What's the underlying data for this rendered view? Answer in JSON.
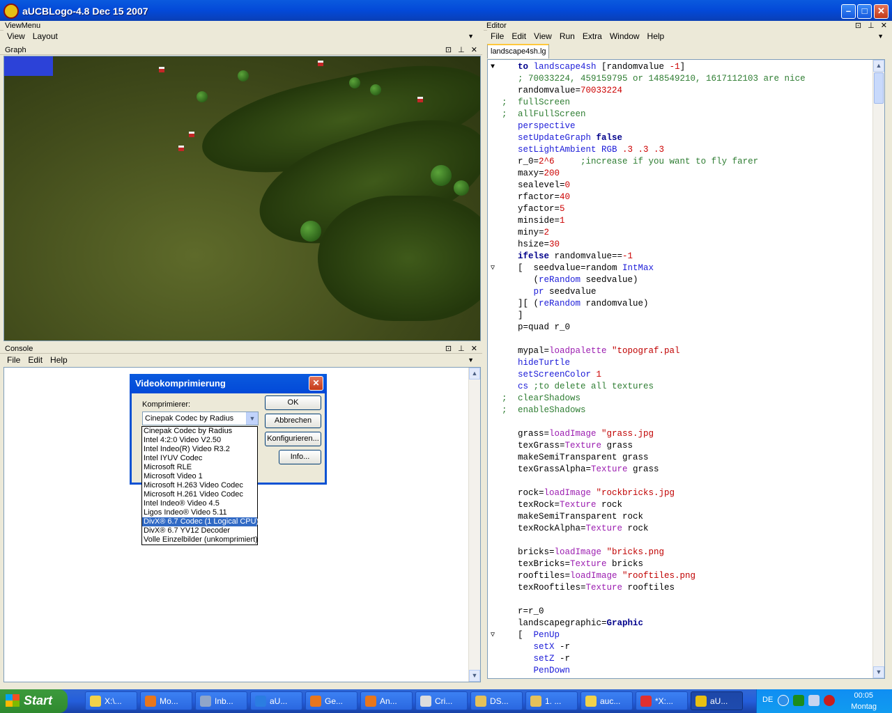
{
  "window": {
    "title": "aUCBLogo-4.8 Dec 15 2007"
  },
  "viewmenu": {
    "header": "ViewMenu",
    "items": [
      "View",
      "Layout"
    ]
  },
  "graph": {
    "header": "Graph"
  },
  "console": {
    "header": "Console",
    "menu": [
      "File",
      "Edit",
      "Help"
    ]
  },
  "editor": {
    "header": "Editor",
    "menu": [
      "File",
      "Edit",
      "View",
      "Run",
      "Extra",
      "Window",
      "Help"
    ],
    "tab": "landscape4sh.lg"
  },
  "dialog": {
    "title": "Videokomprimierung",
    "label": "Komprimierer:",
    "selected": "Cinepak Codec by Radius",
    "buttons": {
      "ok": "OK",
      "cancel": "Abbrechen",
      "configure": "Konfigurieren...",
      "info": "Info..."
    },
    "options": [
      "Cinepak Codec by Radius",
      "Intel 4:2:0 Video V2.50",
      "Intel Indeo(R) Video R3.2",
      "Intel IYUV Codec",
      "Microsoft RLE",
      "Microsoft Video 1",
      "Microsoft H.263 Video Codec",
      "Microsoft H.261 Video Codec",
      "Intel Indeo® Video 4.5",
      "Ligos Indeo® Video 5.11",
      "DivX® 6.7 Codec (1 Logical CPU)",
      "DivX® 6.7 YV12 Decoder",
      "Volle Einzelbilder (unkomprimiert)"
    ],
    "highlighted_index": 10
  },
  "code_lines": [
    {
      "fold": "▼",
      "segs": [
        [
          "k",
          "to "
        ],
        [
          "f",
          "landscape4sh "
        ],
        [
          "t",
          "[randomvalue "
        ],
        [
          "n",
          "-1"
        ],
        [
          "t",
          "]"
        ]
      ]
    },
    {
      "segs": [
        [
          "c",
          "; 70033224, 459159795 or 148549210, 1617112103 are nice"
        ]
      ]
    },
    {
      "segs": [
        [
          "t",
          "randomvalue="
        ],
        [
          "n",
          "70033224"
        ]
      ]
    },
    {
      "semi": true,
      "segs": [
        [
          "c",
          "fullScreen"
        ]
      ]
    },
    {
      "semi": true,
      "segs": [
        [
          "c",
          "allFullScreen"
        ]
      ]
    },
    {
      "segs": [
        [
          "f",
          "perspective"
        ]
      ]
    },
    {
      "segs": [
        [
          "f",
          "setUpdateGraph "
        ],
        [
          "k",
          "false"
        ]
      ]
    },
    {
      "segs": [
        [
          "f",
          "setLightAmbient RGB "
        ],
        [
          "n",
          ".3 .3 .3"
        ]
      ]
    },
    {
      "segs": [
        [
          "t",
          "r_0="
        ],
        [
          "n",
          "2^6"
        ],
        [
          "c",
          "     ;increase if you want to fly farer"
        ]
      ]
    },
    {
      "segs": [
        [
          "t",
          "maxy="
        ],
        [
          "n",
          "200"
        ]
      ]
    },
    {
      "segs": [
        [
          "t",
          "sealevel="
        ],
        [
          "n",
          "0"
        ]
      ]
    },
    {
      "segs": [
        [
          "t",
          "rfactor="
        ],
        [
          "n",
          "40"
        ]
      ]
    },
    {
      "segs": [
        [
          "t",
          "yfactor="
        ],
        [
          "n",
          "5"
        ]
      ]
    },
    {
      "segs": [
        [
          "t",
          "minside="
        ],
        [
          "n",
          "1"
        ]
      ]
    },
    {
      "segs": [
        [
          "t",
          "miny="
        ],
        [
          "n",
          "2"
        ]
      ]
    },
    {
      "segs": [
        [
          "t",
          "hsize="
        ],
        [
          "n",
          "30"
        ]
      ]
    },
    {
      "segs": [
        [
          "k",
          "ifelse "
        ],
        [
          "t",
          "randomvalue=="
        ],
        [
          "n",
          "-1"
        ]
      ]
    },
    {
      "fold": "▽",
      "segs": [
        [
          "t",
          "[  seedvalue=random "
        ],
        [
          "f",
          "IntMax"
        ]
      ]
    },
    {
      "segs": [
        [
          "t",
          "   ("
        ],
        [
          "f",
          "reRandom "
        ],
        [
          "t",
          "seedvalue)"
        ]
      ]
    },
    {
      "segs": [
        [
          "t",
          "   "
        ],
        [
          "f",
          "pr "
        ],
        [
          "t",
          "seedvalue"
        ]
      ]
    },
    {
      "segs": [
        [
          "t",
          "][ ("
        ],
        [
          "f",
          "reRandom "
        ],
        [
          "t",
          "randomvalue)"
        ]
      ]
    },
    {
      "segs": [
        [
          "t",
          "]"
        ]
      ]
    },
    {
      "segs": [
        [
          "t",
          "p=quad r_0"
        ]
      ]
    },
    {
      "segs": []
    },
    {
      "segs": [
        [
          "t",
          "mypal="
        ],
        [
          "p",
          "loadpalette "
        ],
        [
          "s",
          "\"topograf.pal"
        ]
      ]
    },
    {
      "segs": [
        [
          "f",
          "hideTurtle"
        ]
      ]
    },
    {
      "segs": [
        [
          "f",
          "setScreenColor "
        ],
        [
          "n",
          "1"
        ]
      ]
    },
    {
      "segs": [
        [
          "f",
          "cs "
        ],
        [
          "c",
          ";to delete all textures"
        ]
      ]
    },
    {
      "semi": true,
      "segs": [
        [
          "c",
          "clearShadows"
        ]
      ]
    },
    {
      "semi": true,
      "segs": [
        [
          "c",
          "enableShadows"
        ]
      ]
    },
    {
      "segs": []
    },
    {
      "segs": [
        [
          "t",
          "grass="
        ],
        [
          "p",
          "loadImage "
        ],
        [
          "s",
          "\"grass.jpg"
        ]
      ]
    },
    {
      "segs": [
        [
          "t",
          "texGrass="
        ],
        [
          "p",
          "Texture "
        ],
        [
          "t",
          "grass"
        ]
      ]
    },
    {
      "segs": [
        [
          "t",
          "makeSemiTransparent grass"
        ]
      ]
    },
    {
      "segs": [
        [
          "t",
          "texGrassAlpha="
        ],
        [
          "p",
          "Texture "
        ],
        [
          "t",
          "grass"
        ]
      ]
    },
    {
      "segs": []
    },
    {
      "segs": [
        [
          "t",
          "rock="
        ],
        [
          "p",
          "loadImage "
        ],
        [
          "s",
          "\"rockbricks.jpg"
        ]
      ]
    },
    {
      "segs": [
        [
          "t",
          "texRock="
        ],
        [
          "p",
          "Texture "
        ],
        [
          "t",
          "rock"
        ]
      ]
    },
    {
      "segs": [
        [
          "t",
          "makeSemiTransparent rock"
        ]
      ]
    },
    {
      "segs": [
        [
          "t",
          "texRockAlpha="
        ],
        [
          "p",
          "Texture "
        ],
        [
          "t",
          "rock"
        ]
      ]
    },
    {
      "segs": []
    },
    {
      "segs": [
        [
          "t",
          "bricks="
        ],
        [
          "p",
          "loadImage "
        ],
        [
          "s",
          "\"bricks.png"
        ]
      ]
    },
    {
      "segs": [
        [
          "t",
          "texBricks="
        ],
        [
          "p",
          "Texture "
        ],
        [
          "t",
          "bricks"
        ]
      ]
    },
    {
      "segs": [
        [
          "t",
          "rooftiles="
        ],
        [
          "p",
          "loadImage "
        ],
        [
          "s",
          "\"rooftiles.png"
        ]
      ]
    },
    {
      "segs": [
        [
          "t",
          "texRooftiles="
        ],
        [
          "p",
          "Texture "
        ],
        [
          "t",
          "rooftiles"
        ]
      ]
    },
    {
      "segs": []
    },
    {
      "segs": [
        [
          "t",
          "r=r_0"
        ]
      ]
    },
    {
      "segs": [
        [
          "t",
          "landscapegraphic="
        ],
        [
          "k",
          "Graphic"
        ]
      ]
    },
    {
      "fold": "▽",
      "segs": [
        [
          "t",
          "[  "
        ],
        [
          "f",
          "PenUp"
        ]
      ]
    },
    {
      "segs": [
        [
          "t",
          "   "
        ],
        [
          "f",
          "setX "
        ],
        [
          "t",
          "-r"
        ]
      ]
    },
    {
      "segs": [
        [
          "t",
          "   "
        ],
        [
          "f",
          "setZ "
        ],
        [
          "t",
          "-r"
        ]
      ]
    },
    {
      "segs": [
        [
          "t",
          "   "
        ],
        [
          "f",
          "PenDown"
        ]
      ]
    }
  ],
  "taskbar": {
    "start": "Start",
    "tasks": [
      {
        "label": "X:\\...",
        "color": "#f2d24a"
      },
      {
        "label": "Mo...",
        "color": "#e8761c"
      },
      {
        "label": "Inb...",
        "color": "#8fa6c9"
      },
      {
        "label": "aU...",
        "color": "#2b7de1"
      },
      {
        "label": "Ge...",
        "color": "#e8761c"
      },
      {
        "label": "An...",
        "color": "#e8761c"
      },
      {
        "label": "Cri...",
        "color": "#dddddd"
      },
      {
        "label": "DS...",
        "color": "#e5c15a"
      },
      {
        "label": "1. ...",
        "color": "#e5c15a"
      },
      {
        "label": "auc...",
        "color": "#f2d24a"
      },
      {
        "label": "*X:...",
        "color": "#e03030"
      },
      {
        "label": "aU...",
        "color": "#e8c012"
      }
    ],
    "tray": {
      "lang": "DE",
      "time": "00:05",
      "day": "Montag"
    }
  }
}
